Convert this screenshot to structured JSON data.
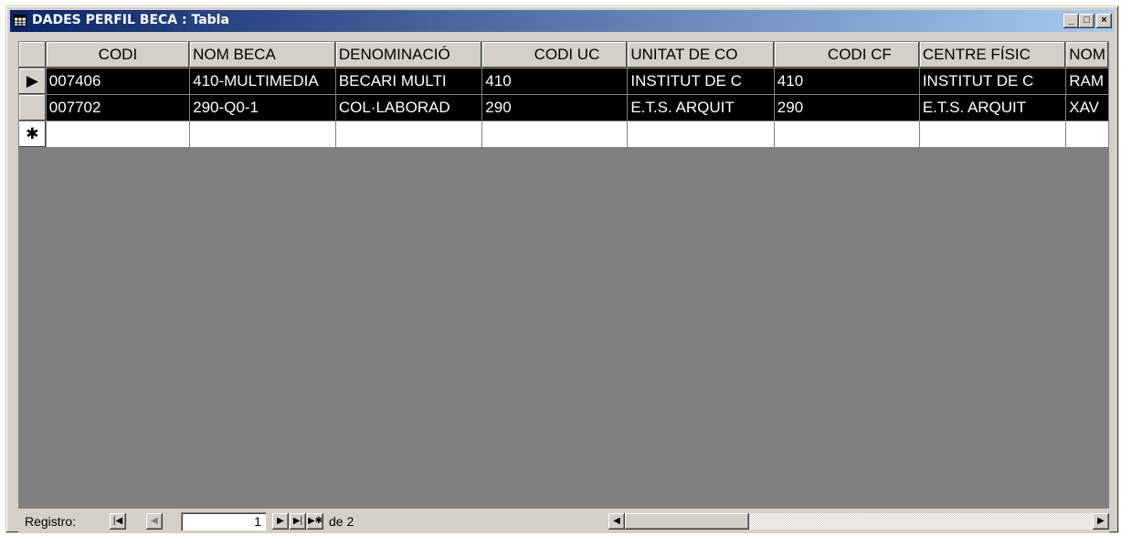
{
  "window": {
    "title": "DADES PERFIL BECA : Tabla",
    "minimize_label": "_",
    "restore_label": "□",
    "close_label": "×"
  },
  "table": {
    "columns": [
      "CODI",
      "NOM BECA",
      "DENOMINACIÓ",
      "CODI UC",
      "UNITAT DE CO",
      "CODI CF",
      "CENTRE FÍSIC",
      "NOM"
    ],
    "rows": [
      [
        "007406",
        "410-MULTIMEDIA",
        "BECARI MULTI",
        "410",
        "INSTITUT DE C",
        "410",
        "INSTITUT DE C",
        "RAM"
      ],
      [
        "007702",
        "290-Q0-1",
        "COL·LABORAD",
        "290",
        "E.T.S. ARQUIT",
        "290",
        "E.T.S. ARQUIT",
        "XAV"
      ]
    ],
    "current_row_marker": "▶",
    "new_row_marker": "✱"
  },
  "status": {
    "record_label": "Registro:",
    "current_record": "1",
    "of_label": "de 2",
    "first_btn": "|◀",
    "prev_btn": "◀",
    "next_btn": "▶",
    "last_btn": "▶|",
    "new_btn": "▶✱"
  },
  "colors": {
    "titlebar_start": "#0a246a",
    "titlebar_end": "#a6caf0",
    "selected_row_bg": "#000000",
    "empty_area": "#808080"
  }
}
